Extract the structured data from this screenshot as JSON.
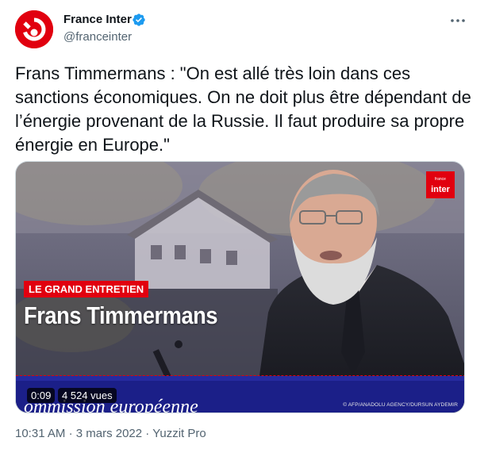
{
  "author": {
    "name": "France Inter",
    "handle": "@franceinter"
  },
  "tweet": {
    "text": "Frans Timmermans : \"On est allé très loin dans ces sanctions économiques. On ne doit plus être dépendant de l’énergie provenant de la Russie. Il faut produire sa propre énergie en Europe.\""
  },
  "media": {
    "brand_small": "france",
    "brand": "inter",
    "badge": "LE GRAND ENTRETIEN",
    "headline": "Frans Timmermans",
    "duration": "0:09",
    "views": "4 524 vues",
    "credit": "© AFP/ANADOLU AGENCY/DURSUN AYDEMIR",
    "banner_text": "ommission européenne"
  },
  "meta": {
    "time": "10:31 AM",
    "separator1": "·",
    "date": "3 mars 2022",
    "separator2": "·",
    "source": "Yuzzit Pro"
  },
  "colors": {
    "brand_red": "#e1000f",
    "verified_blue": "#1d9bf0",
    "secondary_text": "#536471"
  },
  "icons": [
    "france-inter-logo-icon",
    "verified-badge-icon",
    "more-options-icon"
  ]
}
